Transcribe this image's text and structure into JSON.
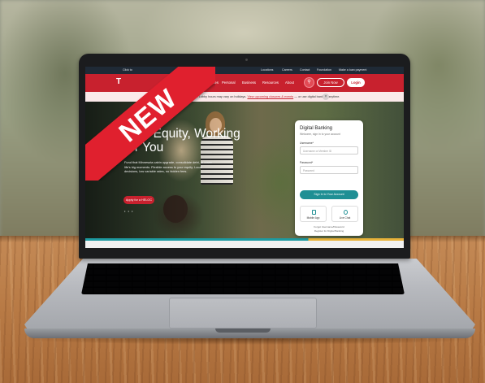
{
  "ribbon": {
    "label": "NEW"
  },
  "website": {
    "topbar": {
      "phone": "Click to",
      "links": [
        "Locations",
        "Careers",
        "Contact",
        "Foundation",
        "Make a loan payment"
      ]
    },
    "nav": {
      "logo": "T",
      "links": [
        "Rates",
        "Personal",
        "Business",
        "Resources",
        "About"
      ],
      "join_label": "Join Now",
      "login_label": "Login"
    },
    "alert": {
      "text": "nder: Lobby hours may vary on holidays.",
      "link": "View upcoming closures & events",
      "tail": "— or use digital banking anytime.",
      "close": "×"
    },
    "hero": {
      "title": "Your Equity, Working for You",
      "description": "Fund that Minnesota cabin upgrade, consolidate debt, or cover life's big moments. Flexible access to your equity. Local decisions, low variable rates, no hidden fees.",
      "cta": "Apply for a HELOC",
      "dots": "• • •"
    },
    "login_card": {
      "title": "Digital Banking",
      "subtitle": "Welcome, sign in to your account",
      "username_label": "Username*",
      "username_placeholder": "Username or Member ID",
      "password_label": "Password*",
      "password_placeholder": "Password",
      "signin_label": "Sign In to Your Account",
      "mobile_label": "Mobile App",
      "chat_label": "Live Chat",
      "forgot_label": "Forgot Username/Password",
      "register_label": "Register for Digital Banking"
    }
  },
  "colors": {
    "brand_red": "#c8212e",
    "ribbon_red": "#e0202e",
    "teal": "#1f8f94",
    "topbar": "#1f2a36"
  }
}
